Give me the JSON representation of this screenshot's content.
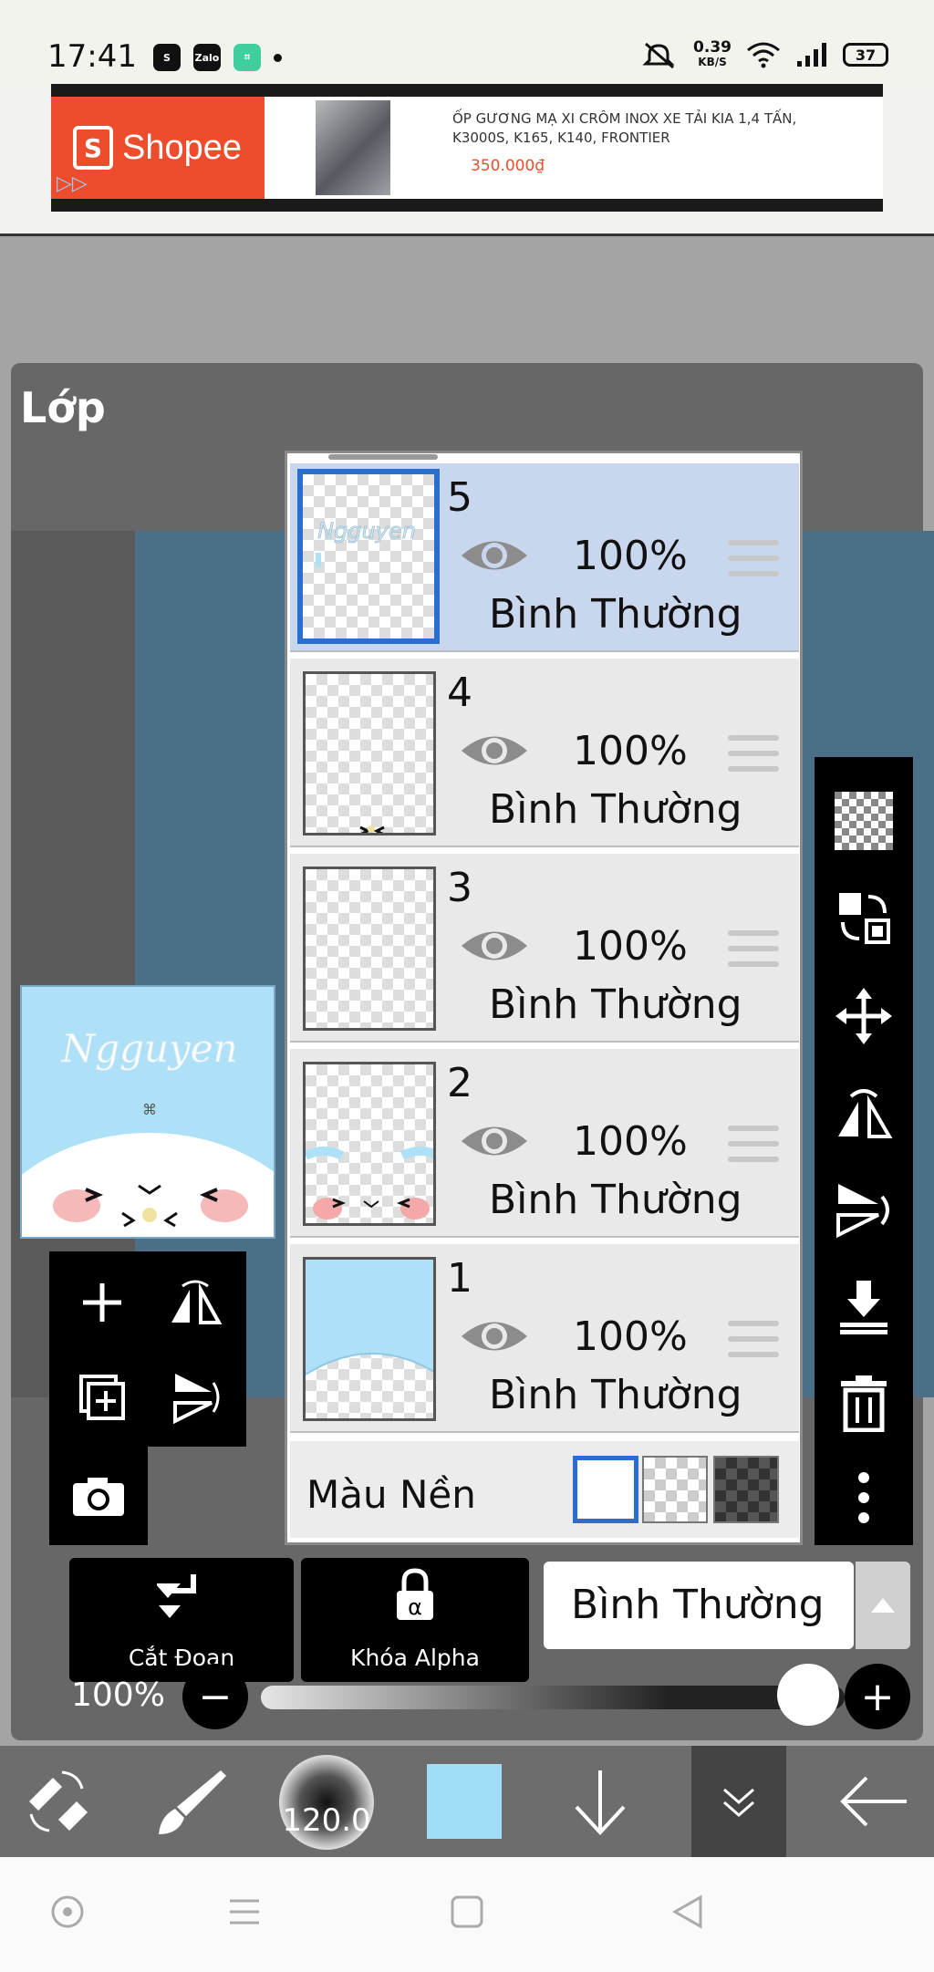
{
  "status_bar": {
    "time": "17:41",
    "app_icons": [
      "S",
      "Zalo",
      "⌗"
    ],
    "net_speed_value": "0.39",
    "net_speed_unit": "KB/S",
    "battery": "37"
  },
  "ad": {
    "brand": "Shopee",
    "brand_glyph": "S",
    "product_title": "ỐP GƯƠNG MẠ XI CRÔM INOX XE TẢI KIA 1,4 TẤN, K3000S, K165, K140, FRONTIER",
    "price": "350.000₫",
    "colors": {
      "shopee": "#ee4d2d"
    }
  },
  "panel": {
    "title": "Lớp"
  },
  "preview": {
    "text": "Ngguyen"
  },
  "layers": [
    {
      "number": "5",
      "opacity": "100%",
      "blend": "Bình Thường",
      "selected": true
    },
    {
      "number": "4",
      "opacity": "100%",
      "blend": "Bình Thường",
      "selected": false
    },
    {
      "number": "3",
      "opacity": "100%",
      "blend": "Bình Thường",
      "selected": false
    },
    {
      "number": "2",
      "opacity": "100%",
      "blend": "Bình Thường",
      "selected": false
    },
    {
      "number": "1",
      "opacity": "100%",
      "blend": "Bình Thường",
      "selected": false
    }
  ],
  "background_row": {
    "label": "Màu Nền",
    "options": [
      "white",
      "transparent-checker",
      "dark-checker"
    ],
    "selected": "white"
  },
  "left_tools": [
    "add-layer-icon",
    "flip-horizontal-icon",
    "add-copy-icon",
    "flip-vertical-icon",
    "camera-icon"
  ],
  "right_tools": [
    "transparency-icon",
    "select-transform-icon",
    "move-icon",
    "flip-horizontal-rotate-icon",
    "flip-vertical-rotate-icon",
    "merge-down-icon",
    "trash-icon",
    "more-icon"
  ],
  "controls": {
    "clip_label": "Cắt Đoạn",
    "alpha_lock_label": "Khóa Alpha",
    "alpha_symbol": "α",
    "blend_mode": "Bình Thường",
    "opacity_label": "100%",
    "opacity_value": 1.0,
    "minus": "−",
    "plus": "+"
  },
  "toolbar": {
    "brush_size": "120.0",
    "current_color": "#9fdcf6"
  }
}
